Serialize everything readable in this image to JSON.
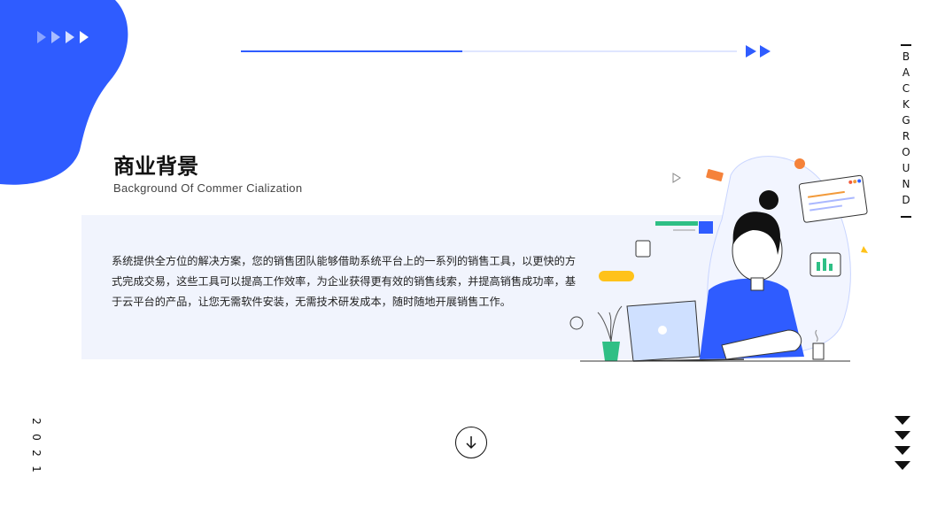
{
  "header": {
    "title": "商业背景",
    "subtitle": "Background Of Commer Cialization"
  },
  "side": {
    "vertical_label": [
      "B",
      "A",
      "C",
      "K",
      "G",
      "R",
      "O",
      "U",
      "N",
      "D"
    ],
    "year_digits": [
      "2",
      "0",
      "2",
      "1"
    ]
  },
  "content": {
    "paragraph": "系统提供全方位的解决方案，您的销售团队能够借助系统平台上的一系列的销售工具，以更快的方式完成交易，这些工具可以提高工作效率，为企业获得更有效的销售线索，并提高销售成功率，基于云平台的产品，让您无需软件安装，无需技术研发成本，随时随地开展销售工作。"
  },
  "colors": {
    "accent": "#2f5cff",
    "panel_bg": "#f1f4fd",
    "text": "#222222"
  },
  "icons": [
    "arrow-down-icon",
    "chevron-down-icon",
    "double-arrow-right-icon"
  ]
}
